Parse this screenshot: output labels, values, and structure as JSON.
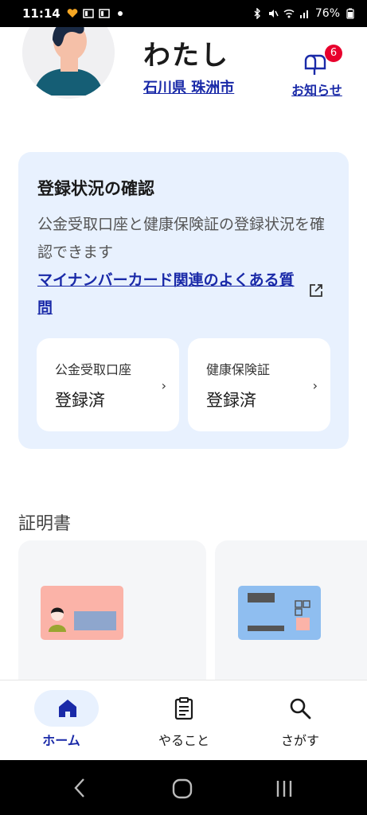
{
  "status_bar": {
    "time": "11:14",
    "battery": "76%",
    "icons_left": [
      "carrier-heart-icon",
      "news-icon",
      "news-icon",
      "dot-icon"
    ],
    "icons_right": [
      "bluetooth-icon",
      "mute-icon",
      "wifi-icon",
      "signal-icon",
      "battery-icon"
    ]
  },
  "profile": {
    "name": "わたし",
    "city": "石川県 珠洲市"
  },
  "notice": {
    "label": "お知らせ",
    "badge": "6"
  },
  "registration": {
    "title": "登録状況の確認",
    "description": "公金受取口座と健康保険証の登録状況を確認できます",
    "link": "マイナンバーカード関連のよくある質問",
    "cards": [
      {
        "label": "公金受取口座",
        "value": "登録済"
      },
      {
        "label": "健康保険証",
        "value": "登録済"
      }
    ]
  },
  "certificates": {
    "title": "証明書"
  },
  "bottom_nav": {
    "items": [
      {
        "label": "ホーム",
        "icon": "home-icon",
        "active": true
      },
      {
        "label": "やること",
        "icon": "clipboard-icon",
        "active": false
      },
      {
        "label": "さがす",
        "icon": "search-icon",
        "active": false
      }
    ]
  },
  "colors": {
    "accent": "#1a2aa8",
    "card_bg": "#e8f1fe",
    "badge": "#e8002d"
  }
}
